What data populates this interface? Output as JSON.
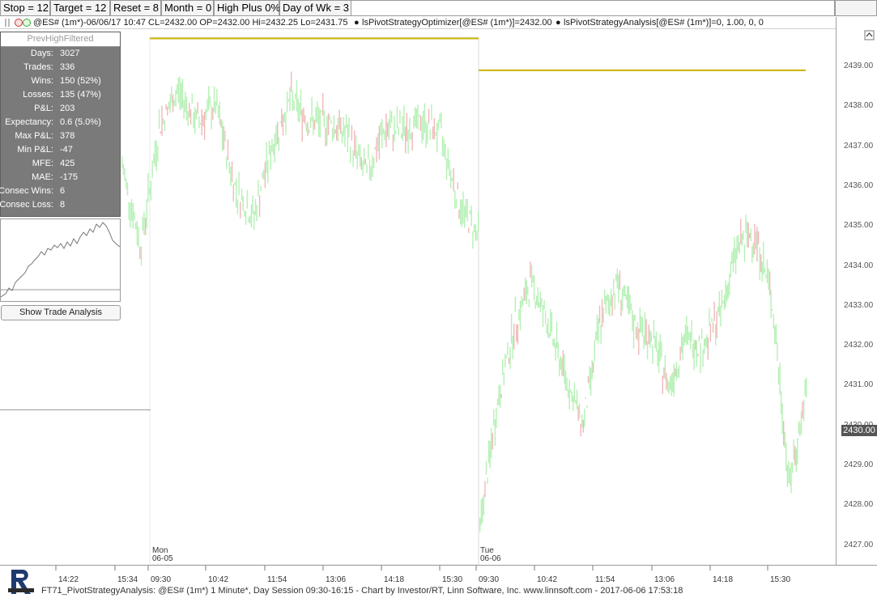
{
  "params": [
    "Stop = 12",
    "Target = 12",
    "Reset = 8",
    "Month = 0",
    "High Plus 0%",
    "Day of Wk = 3"
  ],
  "info": {
    "symbol": "@ES# (1m*)-06/06/17 10:47 CL=2432.00 OP=2432.00 Hi=2432.25 Lo=2431.75",
    "optimizer": "lsPivotStrategyOptimizer[@ES# (1m*)]=2432.00",
    "analysis": "lsPivotStrategyAnalysis[@ES# (1m*)]=0, 1.00, 0, 0"
  },
  "stats": {
    "header": "PrevHighFiltered",
    "rows": [
      {
        "label": "Days:",
        "value": "3027"
      },
      {
        "label": "Trades:",
        "value": "336"
      },
      {
        "label": "Wins:",
        "value": "150 (52%)"
      },
      {
        "label": "Losses:",
        "value": "135 (47%)"
      },
      {
        "label": "P&L:",
        "value": "203"
      },
      {
        "label": "Expectancy:",
        "value": "0.6 (5.0%)"
      },
      {
        "label": "Max P&L:",
        "value": "378"
      },
      {
        "label": "Min P&L:",
        "value": "-47"
      },
      {
        "label": "MFE:",
        "value": "425"
      },
      {
        "label": "MAE:",
        "value": "-175"
      },
      {
        "label": "Consec Wins:",
        "value": "6"
      },
      {
        "label": "Consec Loss:",
        "value": "8"
      }
    ],
    "button": "Show Trade Analysis"
  },
  "chart_data": {
    "type": "bar",
    "y_ticks": [
      "2439.00",
      "2438.00",
      "2437.00",
      "2436.00",
      "2435.00",
      "2434.00",
      "2433.00",
      "2432.00",
      "2431.00",
      "2430.00",
      "2429.00",
      "2428.00",
      "2427.00"
    ],
    "ylim": [
      2426.5,
      2440.3
    ],
    "current_price": "2430.00",
    "x_ticks": [
      "14:22",
      "15:34",
      "09:30",
      "10:42",
      "11:54",
      "13:06",
      "14:18",
      "15:30",
      "09:30",
      "10:42",
      "11:54",
      "13:06",
      "14:18",
      "15:30"
    ],
    "day_labels": [
      {
        "day": "Mon",
        "date": "06-05"
      },
      {
        "day": "Tue",
        "date": "06-06"
      }
    ],
    "pivot_levels": [
      2439.7,
      2438.9
    ],
    "colors": {
      "up": "#b6f0b6",
      "down": "#f0b8b8",
      "pivot": "#c8b400",
      "axis": "#a0a0a0"
    },
    "session1_closes": [
      2436.5,
      2434.5,
      2437.5,
      2438.4,
      2437.6,
      2438.0,
      2436.0,
      2435.2,
      2437.0,
      2438.2,
      2437.6,
      2437.6,
      2437.3,
      2436.3,
      2437.4,
      2437.4,
      2437.6,
      2437.3,
      2435.5,
      2434.8
    ],
    "session2_closes": [
      2427.5,
      2430.5,
      2432.5,
      2433.6,
      2432.5,
      2431.2,
      2430.0,
      2432.6,
      2433.6,
      2432.5,
      2432.2,
      2431.0,
      2432.2,
      2432.0,
      2432.8,
      2434.5,
      2434.8,
      2433.2,
      2428.5,
      2430.8
    ]
  },
  "footer": "FT71_PivotStrategyAnalysis: @ES# (1m*) 1 Minute*, Day Session 09:30-16:15 - Chart by Investor/RT, Linn Software, Inc. www.linnsoft.com - 2017-06-06 17:53:18"
}
